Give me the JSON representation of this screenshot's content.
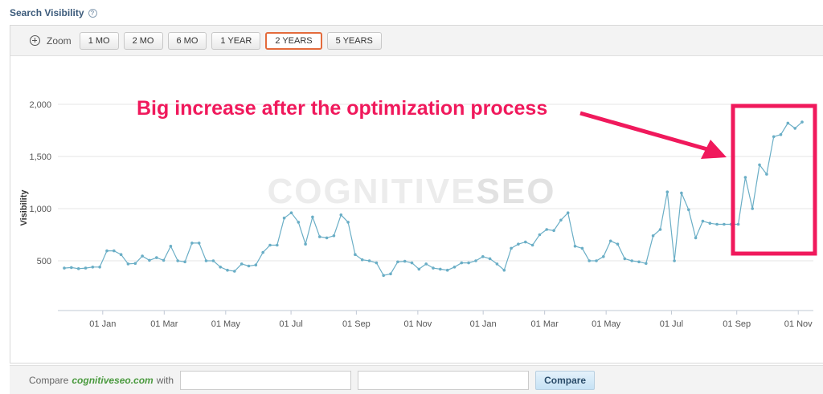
{
  "header": {
    "title": "Search Visibility",
    "help_icon": "question-circle-icon"
  },
  "toolbar": {
    "zoom_label": "Zoom",
    "zoom_icon": "zoom-in-icon",
    "buttons": [
      "1 MO",
      "2 MO",
      "6 MO",
      "1 YEAR",
      "2 YEARS",
      "5 YEARS"
    ],
    "active": "2 YEARS"
  },
  "watermark": {
    "left": "COGNITIVE",
    "right": "SEO"
  },
  "annotation": {
    "text": "Big increase after the optimization process",
    "color": "#f0195c"
  },
  "footer": {
    "compare_prefix": "Compare",
    "site": "cognitiveseo.com",
    "compare_suffix": "with",
    "button": "Compare"
  },
  "colors": {
    "line": "#6aaec6",
    "active_border": "#e46b3c",
    "site_link": "#4a9a3e"
  },
  "chart_data": {
    "type": "line",
    "ylabel": "Visibility",
    "xlabel": "",
    "yticks": [
      500,
      1000,
      1500,
      2000
    ],
    "ytick_labels": [
      "500",
      "1,000",
      "1,500",
      "2,000"
    ],
    "ylim": [
      100,
      2150
    ],
    "xtick_labels": [
      "01 Jan",
      "01 Mar",
      "01 May",
      "01 Jul",
      "01 Sep",
      "01 Nov",
      "01 Jan",
      "01 Mar",
      "01 May",
      "01 Jul",
      "01 Sep",
      "01 Nov"
    ],
    "xtick_positions": [
      5,
      13,
      21,
      29.5,
      38,
      46,
      54.5,
      62.5,
      70.5,
      79,
      87.5,
      95.5
    ],
    "x_count": 97,
    "grid": true,
    "series": [
      {
        "values": [
          430,
          435,
          425,
          430,
          440,
          440,
          595,
          595,
          560,
          470,
          475,
          545,
          505,
          530,
          505,
          640,
          500,
          490,
          670,
          670,
          500,
          500,
          440,
          410,
          400,
          470,
          450,
          460,
          580,
          650,
          650,
          910,
          960,
          870,
          660,
          920,
          730,
          720,
          740,
          940,
          870,
          560,
          510,
          500,
          480,
          360,
          375,
          490,
          495,
          480,
          420,
          470,
          430,
          420,
          410,
          440,
          480,
          480,
          500,
          540,
          520,
          470,
          410,
          620,
          660,
          680,
          650,
          750,
          800,
          790,
          890,
          960,
          640,
          620,
          500,
          500,
          540,
          690,
          660,
          520,
          500,
          490,
          475,
          740,
          800,
          1160,
          500,
          1150,
          990,
          720,
          880,
          860,
          850,
          850,
          850,
          850,
          1300,
          1000,
          1420,
          1330,
          1690,
          1710,
          1820,
          1770,
          1830
        ]
      }
    ]
  }
}
